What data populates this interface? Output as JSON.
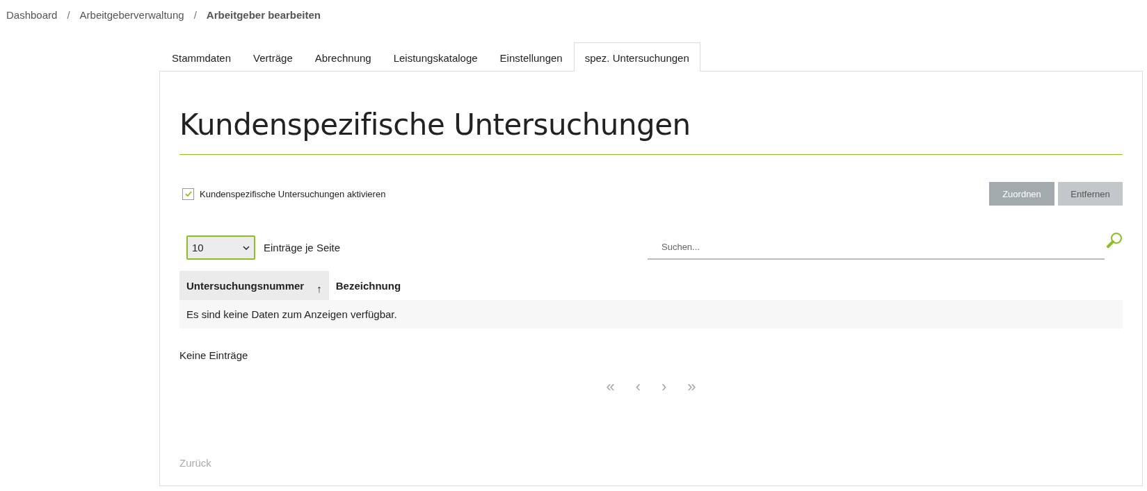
{
  "breadcrumb": [
    {
      "label": "Dashboard",
      "current": false
    },
    {
      "label": "Arbeitgeberverwaltung",
      "current": false
    },
    {
      "label": "Arbeitgeber bearbeiten",
      "current": true
    }
  ],
  "separator": "/",
  "tabs": [
    {
      "label": "Stammdaten",
      "selected": false
    },
    {
      "label": "Verträge",
      "selected": false
    },
    {
      "label": "Abrechnung",
      "selected": false
    },
    {
      "label": "Leistungskataloge",
      "selected": false
    },
    {
      "label": "Einstellungen",
      "selected": false
    },
    {
      "label": "spez. Untersuchungen",
      "selected": true
    }
  ],
  "heading": "Kundenspezifische Untersuchungen",
  "activate": {
    "label": "Kundenspezifische Untersuchungen aktivieren",
    "checked": true
  },
  "buttons": [
    {
      "label": "Zuordnen",
      "kind": "primary"
    },
    {
      "label": "Entfernen",
      "kind": "secondary"
    }
  ],
  "page_size": {
    "value": "10",
    "label": "Einträge je Seite"
  },
  "search": {
    "placeholder": "Suchen..."
  },
  "table": {
    "columns": [
      {
        "label": "Untersuchungsnummer",
        "sorted": true,
        "sort_mark": "↑"
      },
      {
        "label": "Bezeichnung",
        "sorted": false
      }
    ],
    "empty_text": "Es sind keine Daten zum Anzeigen verfügbar."
  },
  "entries_info": "Keine Einträge",
  "pager": [
    {
      "label": "«",
      "disabled": true
    },
    {
      "label": "‹",
      "disabled": true
    },
    {
      "label": "›",
      "disabled": true
    },
    {
      "label": "»",
      "disabled": true
    }
  ],
  "back_link": {
    "label": "Zurück",
    "disabled": true
  }
}
